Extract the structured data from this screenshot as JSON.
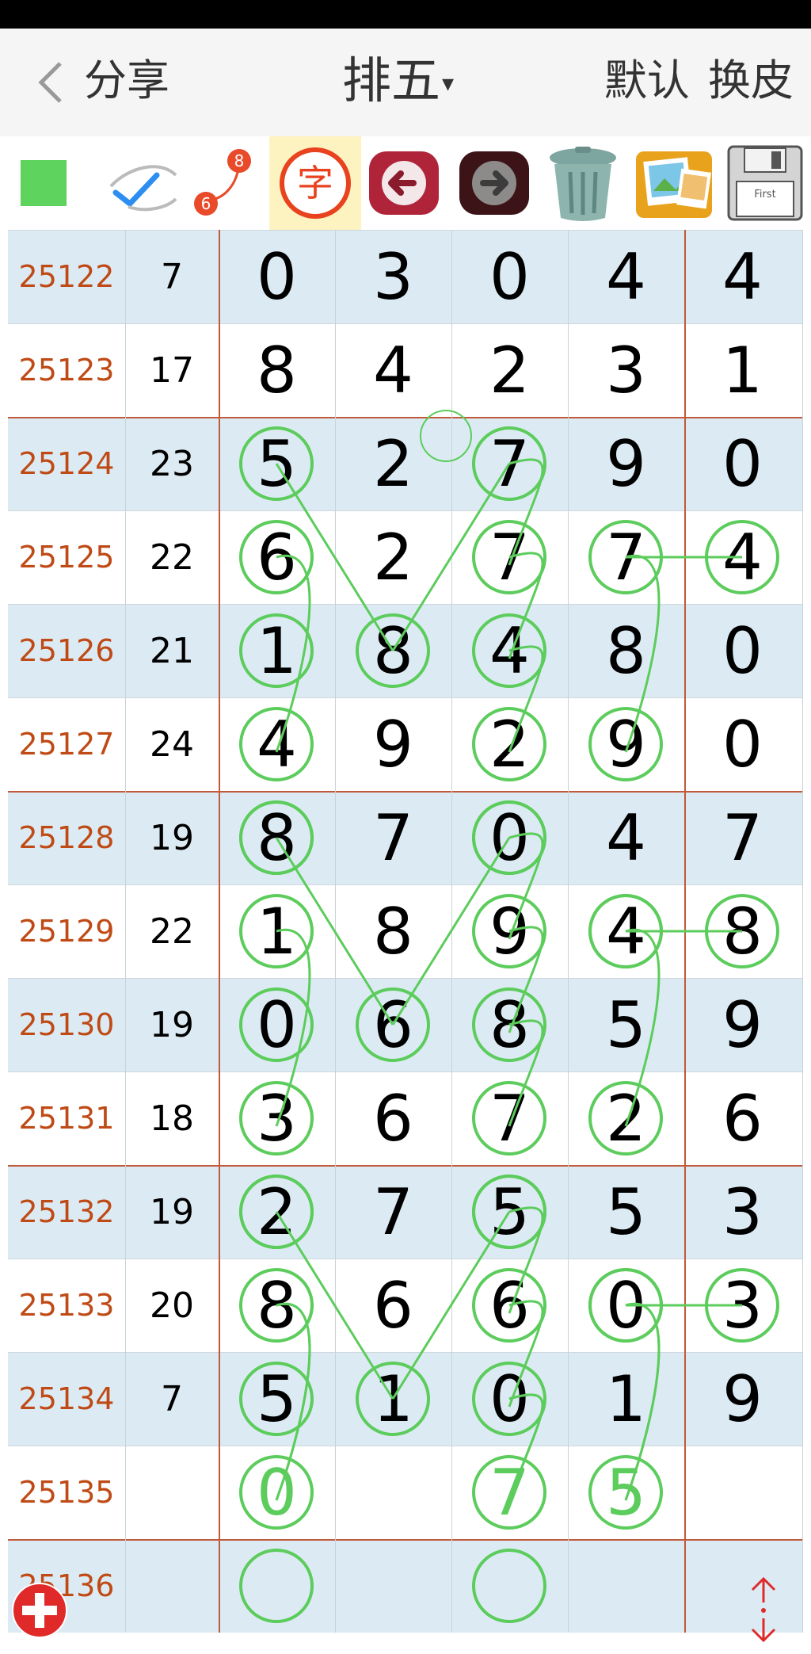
{
  "nav": {
    "back_icon": "chevron-left-icon",
    "share_label": "分享",
    "title": "排五",
    "title_caret": "▾",
    "default_label": "默认",
    "skin_label": "换皮"
  },
  "toolbar": {
    "tools": [
      {
        "name": "green-square-tool-icon",
        "color": "#5ed35e"
      },
      {
        "name": "check-pen-tool-icon"
      },
      {
        "name": "curve-link-6-8-icon",
        "from": "6",
        "to": "8"
      },
      {
        "name": "text-tool-icon",
        "glyph": "字"
      },
      {
        "name": "undo-arrow-icon"
      },
      {
        "name": "redo-arrow-icon"
      },
      {
        "name": "trash-can-icon"
      },
      {
        "name": "photo-album-icon"
      },
      {
        "name": "floppy-save-icon",
        "text": "First"
      }
    ]
  },
  "colors": {
    "issue_text": "#bf4a16",
    "shaded_row": "#dcebf3",
    "circle_stroke": "#5ccc5c",
    "divider_red": "#c05a3a"
  },
  "rows": [
    {
      "issue": "25122",
      "sum": "7",
      "digits": [
        "0",
        "3",
        "0",
        "4",
        "4"
      ]
    },
    {
      "issue": "25123",
      "sum": "17",
      "digits": [
        "8",
        "4",
        "2",
        "3",
        "1"
      ]
    },
    {
      "issue": "25124",
      "sum": "23",
      "digits": [
        "5",
        "2",
        "7",
        "9",
        "0"
      ]
    },
    {
      "issue": "25125",
      "sum": "22",
      "digits": [
        "6",
        "2",
        "7",
        "7",
        "4"
      ]
    },
    {
      "issue": "25126",
      "sum": "21",
      "digits": [
        "1",
        "8",
        "4",
        "8",
        "0"
      ]
    },
    {
      "issue": "25127",
      "sum": "24",
      "digits": [
        "4",
        "9",
        "2",
        "9",
        "0"
      ]
    },
    {
      "issue": "25128",
      "sum": "19",
      "digits": [
        "8",
        "7",
        "0",
        "4",
        "7"
      ]
    },
    {
      "issue": "25129",
      "sum": "22",
      "digits": [
        "1",
        "8",
        "9",
        "4",
        "8"
      ]
    },
    {
      "issue": "25130",
      "sum": "19",
      "digits": [
        "0",
        "6",
        "8",
        "5",
        "9"
      ]
    },
    {
      "issue": "25131",
      "sum": "18",
      "digits": [
        "3",
        "6",
        "7",
        "2",
        "6"
      ]
    },
    {
      "issue": "25132",
      "sum": "19",
      "digits": [
        "2",
        "7",
        "5",
        "5",
        "3"
      ]
    },
    {
      "issue": "25133",
      "sum": "20",
      "digits": [
        "8",
        "6",
        "6",
        "0",
        "3"
      ]
    },
    {
      "issue": "25134",
      "sum": "7",
      "digits": [
        "5",
        "1",
        "0",
        "1",
        "9"
      ]
    },
    {
      "issue": "25135",
      "sum": "",
      "digits": [
        "0",
        "",
        "7",
        "5",
        ""
      ],
      "predicted": true
    },
    {
      "issue": "25136",
      "sum": "",
      "digits": [
        "",
        "",
        "",
        "",
        ""
      ]
    }
  ],
  "footer": {
    "add_icon": "plus-circle-icon",
    "scroll_icon": "up-down-arrows-icon"
  }
}
